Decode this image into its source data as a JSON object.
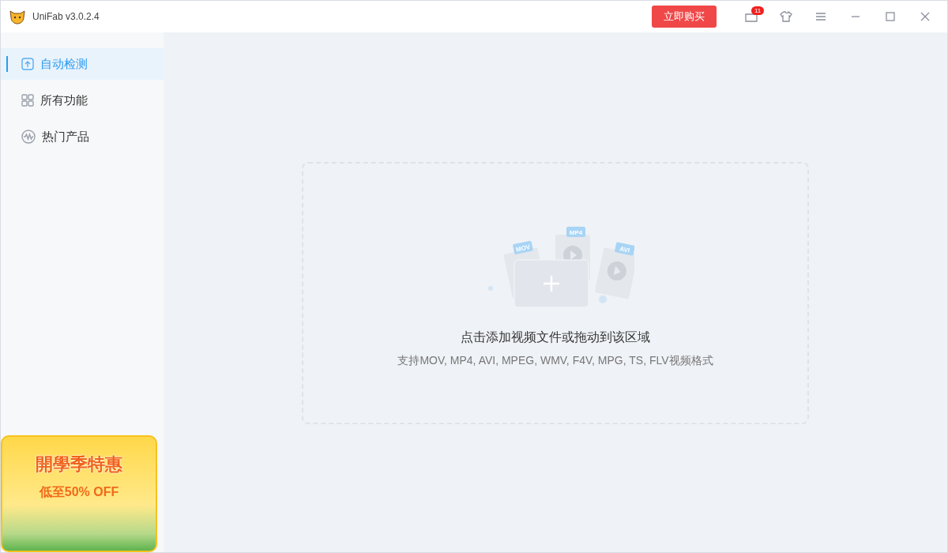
{
  "window": {
    "title": "UniFab v3.0.2.4",
    "buy_button": "立即购买",
    "notification_count": "11"
  },
  "sidebar": {
    "items": [
      {
        "label": "自动检测",
        "selected": true
      },
      {
        "label": "所有功能",
        "selected": false
      },
      {
        "label": "热门产品",
        "selected": false
      }
    ]
  },
  "promo": {
    "title": "開學季特惠",
    "subtitle": "低至50% OFF"
  },
  "drop_zone": {
    "file_badges": [
      "MOV",
      "MP4",
      "AVI"
    ],
    "prompt": "点击添加视频文件或拖动到该区域",
    "formats": "支持MOV, MP4, AVI, MPEG, WMV, F4V, MPG, TS, FLV视频格式"
  }
}
